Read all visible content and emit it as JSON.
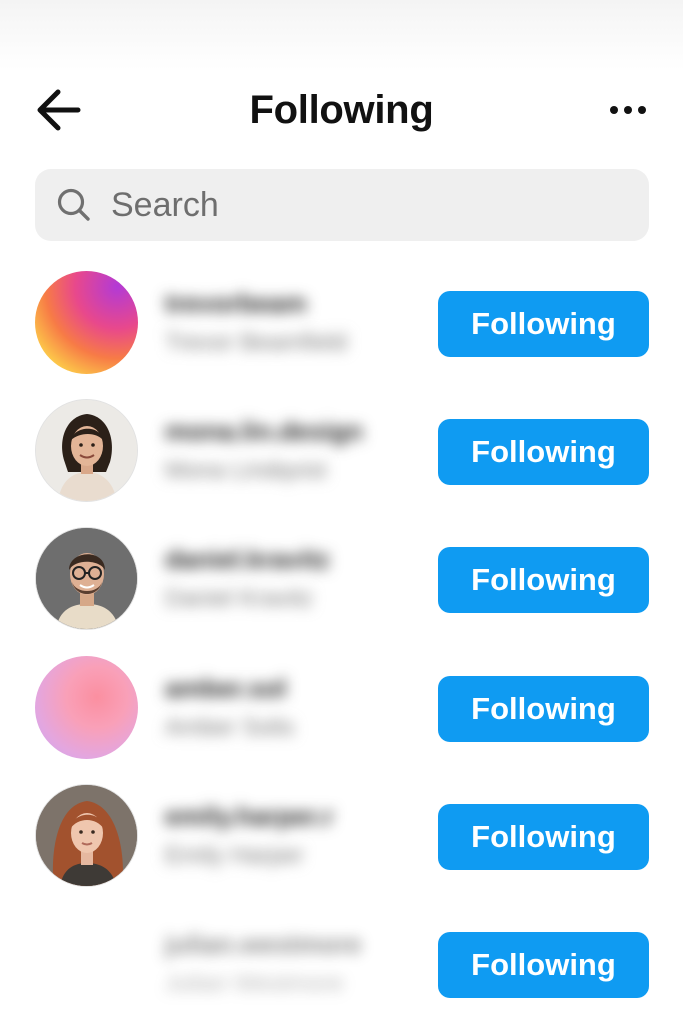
{
  "header": {
    "title": "Following",
    "back_icon": "arrow-left-icon",
    "more_icon": "more-horizontal-icon"
  },
  "search": {
    "placeholder": "Search",
    "value": "",
    "icon": "search-icon"
  },
  "follow_button_color": "#0f9bf2",
  "accounts": [
    {
      "username": "trevorbeam",
      "fullname": "Trevor Beamfield",
      "button_label": "Following",
      "avatar": "gradient-purple-orange-yellow"
    },
    {
      "username": "mona.lin.design",
      "fullname": "Mona Lindqvist",
      "button_label": "Following",
      "avatar": "photo-woman-dark-hair"
    },
    {
      "username": "daniel.kravitz",
      "fullname": "Daniel Kravitz",
      "button_label": "Following",
      "avatar": "photo-man-glasses"
    },
    {
      "username": "amber.sol",
      "fullname": "Amber Solis",
      "button_label": "Following",
      "avatar": "gradient-pink-lilac"
    },
    {
      "username": "emily.harper.r",
      "fullname": "Emily Harper",
      "button_label": "Following",
      "avatar": "photo-woman-red-hair"
    },
    {
      "username": "julian.westmore",
      "fullname": "Julian Westmore",
      "button_label": "Following",
      "avatar": "none"
    }
  ]
}
